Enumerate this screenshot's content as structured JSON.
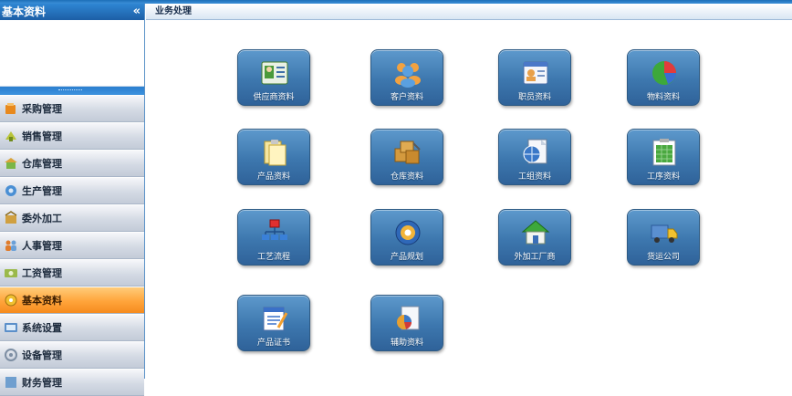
{
  "sidebar": {
    "title": "基本资料",
    "collapse_glyph": "«",
    "items": [
      {
        "label": "采购管理",
        "icon": "purchase-icon",
        "color": "#e8891e",
        "active": false
      },
      {
        "label": "销售管理",
        "icon": "sales-icon",
        "color": "#b8c43a",
        "active": false
      },
      {
        "label": "仓库管理",
        "icon": "warehouse-icon",
        "color": "#7ab648",
        "active": false
      },
      {
        "label": "生产管理",
        "icon": "production-icon",
        "color": "#4a8fd4",
        "active": false
      },
      {
        "label": "委外加工",
        "icon": "outsource-icon",
        "color": "#d0a040",
        "active": false
      },
      {
        "label": "人事管理",
        "icon": "personnel-icon",
        "color": "#e07c2c",
        "active": false
      },
      {
        "label": "工资管理",
        "icon": "salary-icon",
        "color": "#9ab94a",
        "active": false
      },
      {
        "label": "基本资料",
        "icon": "basic-data-icon",
        "color": "#f0c030",
        "active": true
      },
      {
        "label": "系统设置",
        "icon": "settings-icon",
        "color": "#5b8fc9",
        "active": false
      },
      {
        "label": "设备管理",
        "icon": "equipment-icon",
        "color": "#7d8ea3",
        "active": false
      },
      {
        "label": "财务管理",
        "icon": "finance-icon",
        "color": "#6f9fcf",
        "active": false
      }
    ]
  },
  "main": {
    "header": "业务处理",
    "tiles": [
      {
        "label": "供应商资料",
        "icon": "supplier-icon"
      },
      {
        "label": "客户资料",
        "icon": "customer-icon"
      },
      {
        "label": "职员资料",
        "icon": "employee-icon"
      },
      {
        "label": "物料资料",
        "icon": "material-icon"
      },
      {
        "label": "产品资料",
        "icon": "product-icon"
      },
      {
        "label": "仓库资料",
        "icon": "warehouse-data-icon"
      },
      {
        "label": "工组资料",
        "icon": "work-group-icon"
      },
      {
        "label": "工序资料",
        "icon": "process-icon"
      },
      {
        "label": "工艺流程",
        "icon": "workflow-icon"
      },
      {
        "label": "产品规划",
        "icon": "product-planning-icon"
      },
      {
        "label": "外加工厂商",
        "icon": "outsource-factory-icon"
      },
      {
        "label": "货运公司",
        "icon": "freight-company-icon"
      },
      {
        "label": "产品证书",
        "icon": "product-certificate-icon"
      },
      {
        "label": "辅助资料",
        "icon": "auxiliary-data-icon"
      }
    ]
  }
}
